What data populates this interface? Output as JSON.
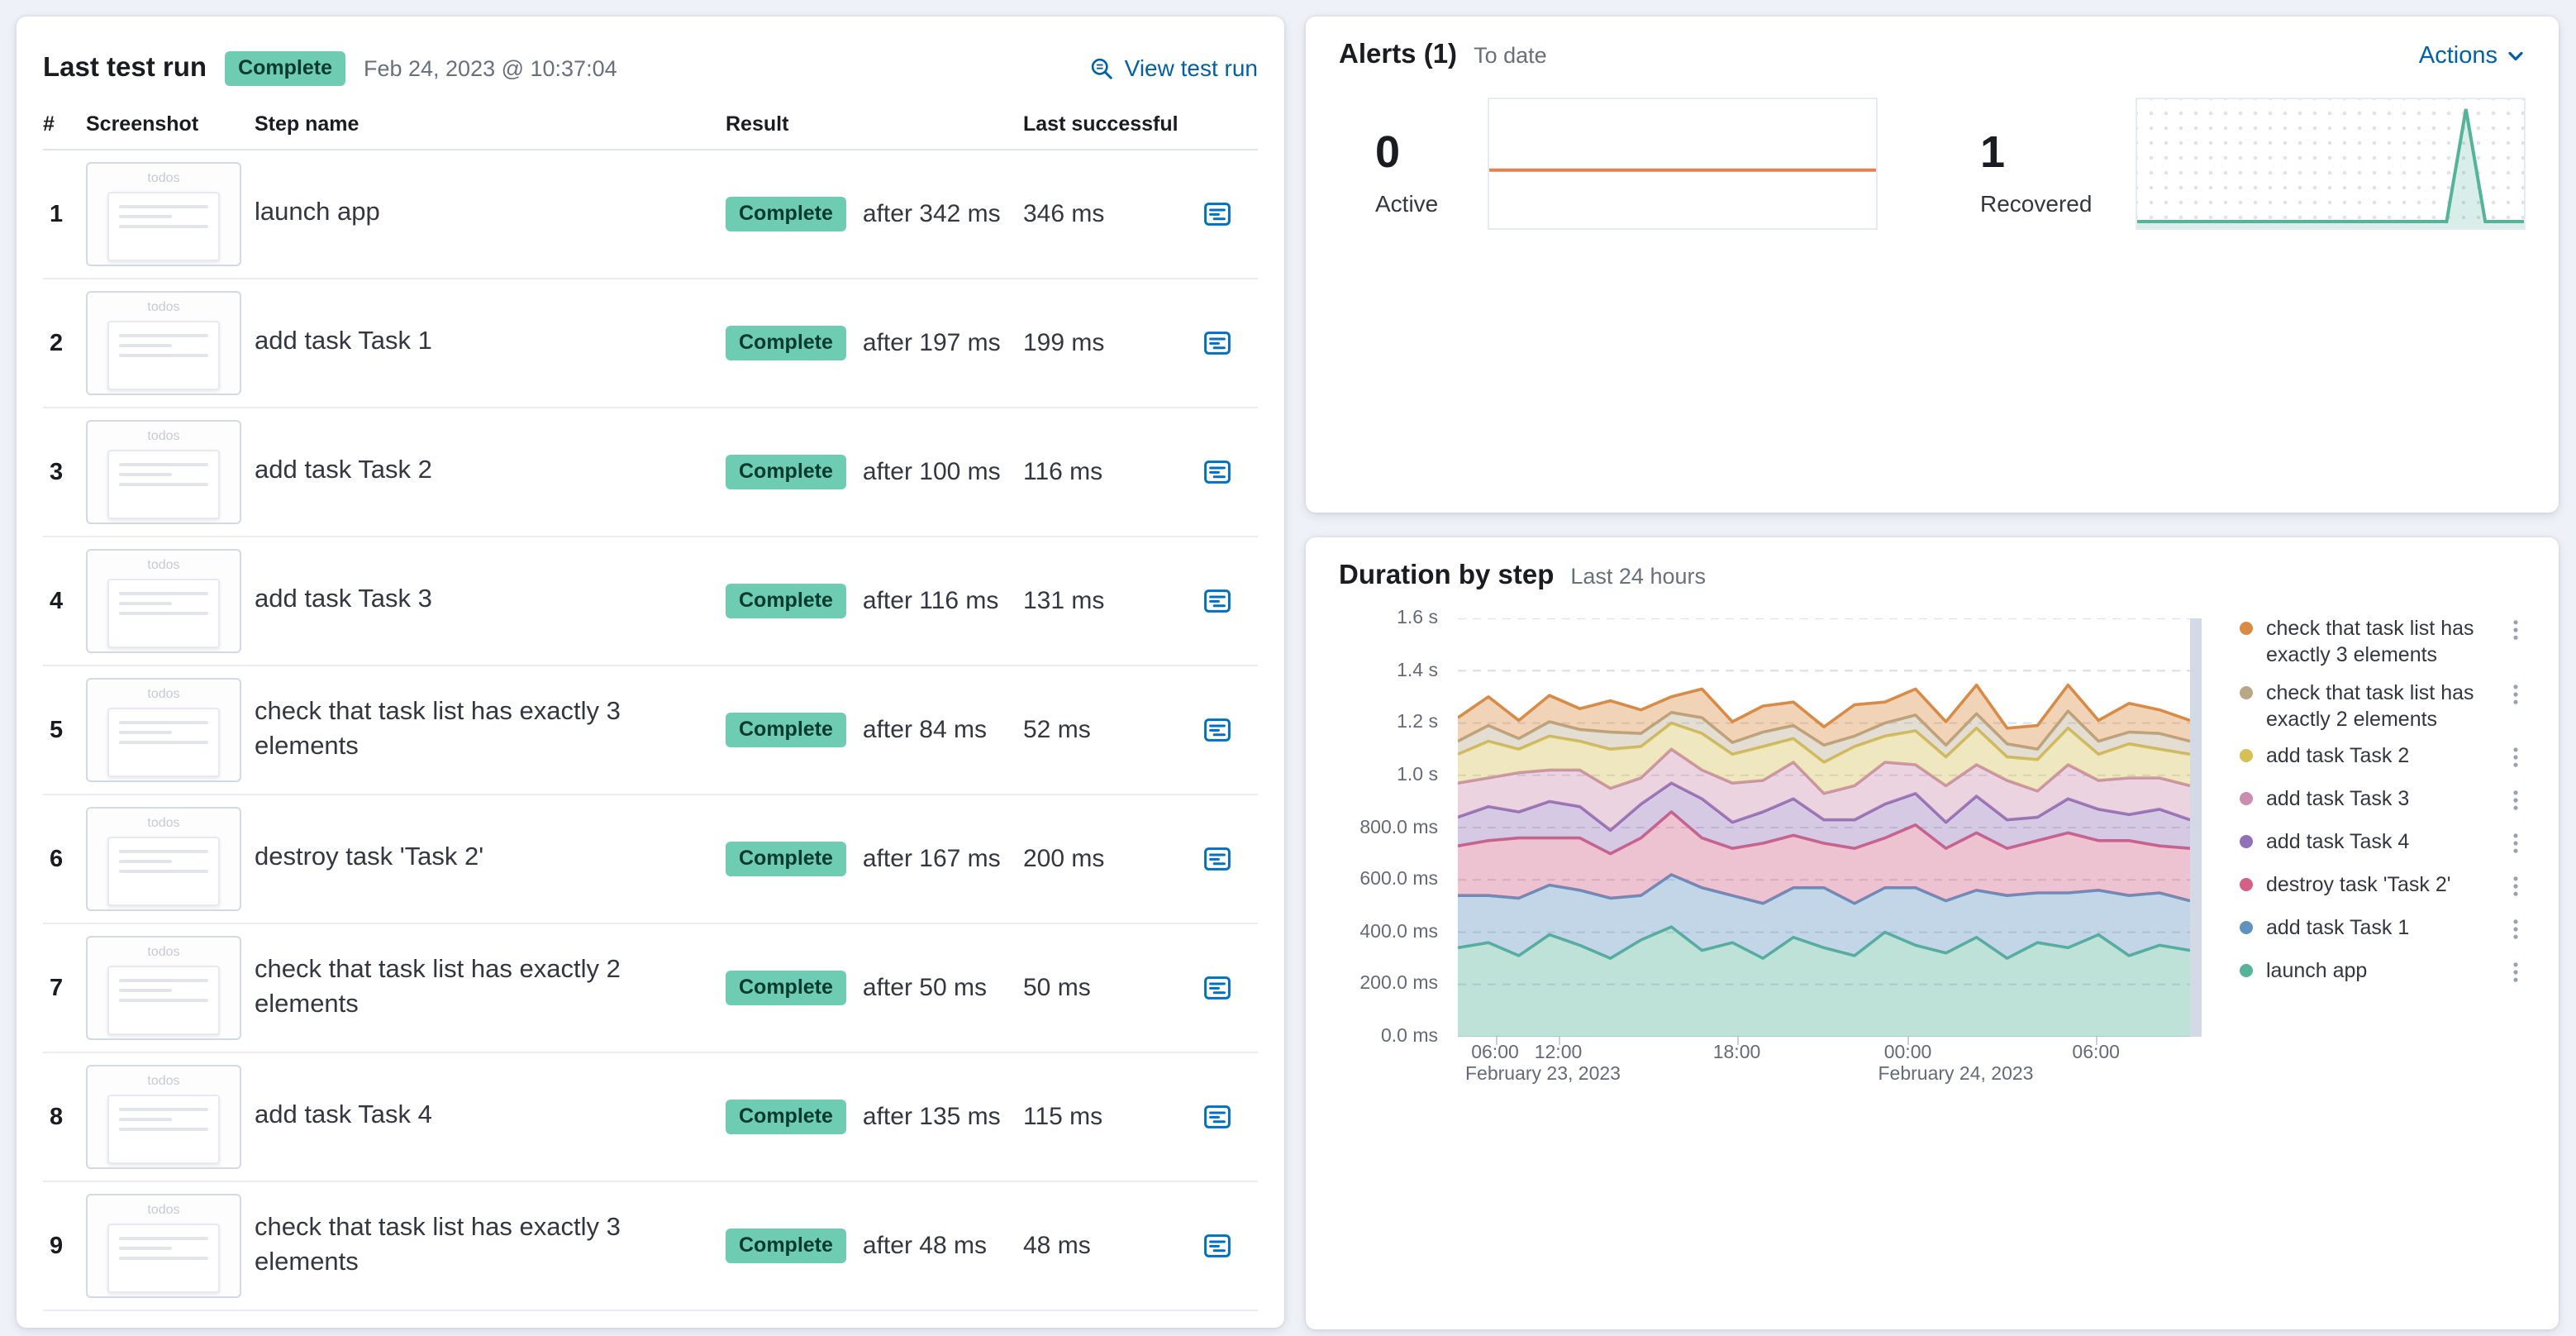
{
  "last_test_run": {
    "title": "Last test run",
    "status_badge": "Complete",
    "timestamp": "Feb 24, 2023 @ 10:37:04",
    "view_link": "View test run",
    "thumbnail_label": "todos",
    "table": {
      "headers": {
        "num": "#",
        "screenshot": "Screenshot",
        "step": "Step name",
        "result": "Result",
        "last_successful": "Last successful"
      },
      "rows": [
        {
          "num": "1",
          "step": "launch app",
          "result_badge": "Complete",
          "result_after": "after 342 ms",
          "last_successful": "346 ms"
        },
        {
          "num": "2",
          "step": "add task Task 1",
          "result_badge": "Complete",
          "result_after": "after 197 ms",
          "last_successful": "199 ms"
        },
        {
          "num": "3",
          "step": "add task Task 2",
          "result_badge": "Complete",
          "result_after": "after 100 ms",
          "last_successful": "116 ms"
        },
        {
          "num": "4",
          "step": "add task Task 3",
          "result_badge": "Complete",
          "result_after": "after 116 ms",
          "last_successful": "131 ms"
        },
        {
          "num": "5",
          "step": "check that task list has exactly 3 elements",
          "result_badge": "Complete",
          "result_after": "after 84 ms",
          "last_successful": "52 ms"
        },
        {
          "num": "6",
          "step": "destroy task 'Task 2'",
          "result_badge": "Complete",
          "result_after": "after 167 ms",
          "last_successful": "200 ms"
        },
        {
          "num": "7",
          "step": "check that task list has exactly 2 elements",
          "result_badge": "Complete",
          "result_after": "after 50 ms",
          "last_successful": "50 ms"
        },
        {
          "num": "8",
          "step": "add task Task 4",
          "result_badge": "Complete",
          "result_after": "after 135 ms",
          "last_successful": "115 ms"
        },
        {
          "num": "9",
          "step": "check that task list has exactly 3 elements",
          "result_badge": "Complete",
          "result_after": "after 48 ms",
          "last_successful": "48 ms"
        }
      ]
    }
  },
  "alerts": {
    "title": "Alerts (1)",
    "subtitle": "To date",
    "actions_label": "Actions",
    "stats": [
      {
        "value": "0",
        "label": "Active",
        "color": "#e8824d"
      },
      {
        "value": "1",
        "label": "Recovered",
        "color": "#54b399"
      }
    ]
  },
  "duration": {
    "title": "Duration by step",
    "subtitle": "Last 24 hours",
    "legend": [
      {
        "label": "check that task list has exactly 3 elements",
        "color": "#d98b45"
      },
      {
        "label": "check that task list has exactly 2 elements",
        "color": "#b9a888"
      },
      {
        "label": "add task Task 2",
        "color": "#d6bf57"
      },
      {
        "label": "add task Task 3",
        "color": "#ca8eae"
      },
      {
        "label": "add task Task 4",
        "color": "#9170b8"
      },
      {
        "label": "destroy task 'Task 2'",
        "color": "#d36086"
      },
      {
        "label": "add task Task 1",
        "color": "#6092c0"
      },
      {
        "label": "launch app",
        "color": "#54b399"
      }
    ]
  },
  "chart_data": [
    {
      "id": "alerts-active",
      "type": "line",
      "title": "Active alerts",
      "subtitle": "To date",
      "color": "#e8824d",
      "values": [
        0,
        0,
        0,
        0,
        0,
        0,
        0,
        0,
        0,
        0,
        0,
        0,
        0,
        0,
        0,
        0,
        0,
        0,
        0,
        0,
        0,
        0,
        0,
        0
      ]
    },
    {
      "id": "alerts-recovered",
      "type": "area",
      "title": "Recovered alerts",
      "subtitle": "To date",
      "color": "#54b399",
      "values": [
        0,
        0,
        0,
        0,
        0,
        0,
        0,
        0,
        0,
        0,
        0,
        0,
        0,
        0,
        0,
        0,
        0,
        1,
        0,
        0,
        0
      ]
    },
    {
      "id": "duration-by-step",
      "type": "stacked-area",
      "title": "Duration by step",
      "subtitle": "Last 24 hours",
      "ylim_ms": [
        0,
        1600
      ],
      "y_ticks": [
        "1.6 s",
        "1.4 s",
        "1.2 s",
        "1.0 s",
        "800.0 ms",
        "600.0 ms",
        "400.0 ms",
        "200.0 ms",
        "0.0 ms"
      ],
      "x_ticks": [
        {
          "label": "06:00",
          "pos": 0.05,
          "date": "February 23, 2023"
        },
        {
          "label": "12:00",
          "pos": 0.135
        },
        {
          "label": "18:00",
          "pos": 0.375
        },
        {
          "label": "00:00",
          "pos": 0.605,
          "date": "February 24, 2023"
        },
        {
          "label": "06:00",
          "pos": 0.858
        }
      ],
      "series": [
        {
          "name": "launch app",
          "color": "#54b399",
          "values": [
            340,
            360,
            310,
            390,
            350,
            300,
            370,
            420,
            330,
            360,
            300,
            380,
            340,
            310,
            400,
            350,
            320,
            380,
            300,
            360,
            340,
            390,
            310,
            350,
            330
          ]
        },
        {
          "name": "add task Task 1",
          "color": "#6092c0",
          "values": [
            200,
            180,
            220,
            190,
            210,
            230,
            170,
            200,
            240,
            180,
            210,
            190,
            230,
            200,
            170,
            220,
            200,
            180,
            240,
            190,
            210,
            170,
            230,
            200,
            190
          ]
        },
        {
          "name": "destroy task 'Task 2'",
          "color": "#d36086",
          "values": [
            190,
            210,
            230,
            180,
            200,
            170,
            220,
            240,
            190,
            180,
            230,
            200,
            170,
            210,
            190,
            240,
            200,
            220,
            180,
            200,
            230,
            190,
            210,
            180,
            200
          ]
        },
        {
          "name": "add task Task 4",
          "color": "#9170b8",
          "values": [
            110,
            130,
            100,
            140,
            120,
            90,
            130,
            110,
            150,
            100,
            120,
            140,
            90,
            110,
            130,
            120,
            100,
            140,
            110,
            90,
            130,
            120,
            100,
            140,
            110
          ]
        },
        {
          "name": "add task Task 3",
          "color": "#ca8eae",
          "values": [
            130,
            110,
            150,
            120,
            140,
            160,
            100,
            130,
            110,
            150,
            120,
            140,
            100,
            130,
            160,
            110,
            140,
            120,
            150,
            100,
            130,
            110,
            140,
            120,
            130
          ]
        },
        {
          "name": "add task Task 2",
          "color": "#d6bf57",
          "values": [
            110,
            140,
            90,
            130,
            110,
            150,
            120,
            100,
            140,
            110,
            130,
            90,
            120,
            150,
            100,
            130,
            110,
            140,
            90,
            120,
            140,
            100,
            130,
            110,
            120
          ]
        },
        {
          "name": "check that task list has exactly 2 elements",
          "color": "#b9a888",
          "values": [
            50,
            60,
            40,
            55,
            45,
            65,
            50,
            40,
            60,
            45,
            55,
            50,
            65,
            40,
            50,
            60,
            45,
            55,
            50,
            40,
            65,
            50,
            45,
            60,
            50
          ]
        },
        {
          "name": "check that task list has exactly 3 elements",
          "color": "#d98b45",
          "values": [
            90,
            110,
            70,
            100,
            80,
            120,
            90,
            60,
            110,
            80,
            100,
            90,
            70,
            120,
            80,
            100,
            90,
            110,
            60,
            90,
            100,
            80,
            110,
            90,
            80
          ]
        }
      ]
    }
  ]
}
